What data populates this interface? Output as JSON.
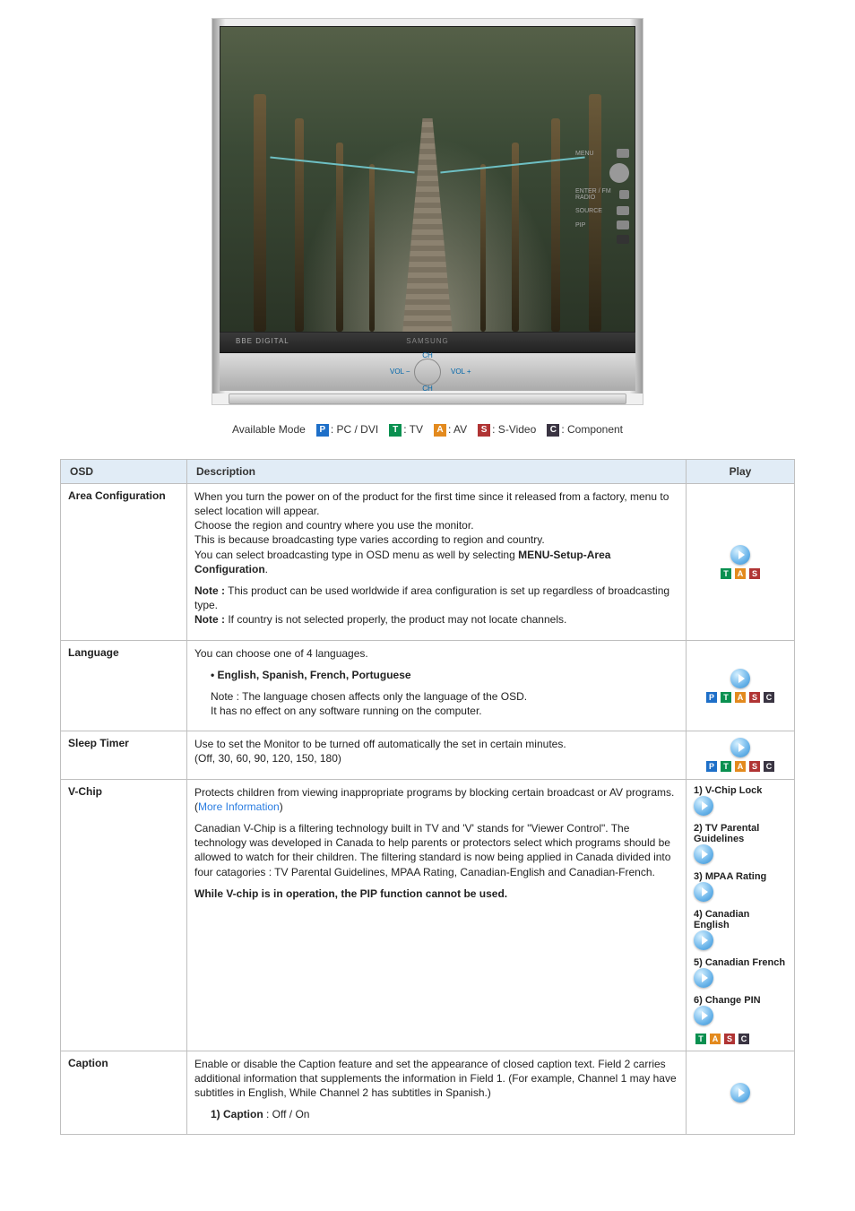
{
  "product_image": {
    "brand_left": "BBE DIGITAL",
    "brand_center": "SAMSUNG",
    "controls": {
      "ch": "CH",
      "vol_minus": "VOL −",
      "vol_plus": "VOL +"
    },
    "side_buttons": [
      "MENU",
      "",
      "ENTER / FM RADIO",
      "SOURCE",
      "PIP",
      ""
    ]
  },
  "mode_line": {
    "prefix": "Available Mode",
    "items": [
      {
        "badge": "P",
        "cls": "m-p",
        "label": ": PC / DVI"
      },
      {
        "badge": "T",
        "cls": "m-t",
        "label": ": TV"
      },
      {
        "badge": "A",
        "cls": "m-a",
        "label": ": AV"
      },
      {
        "badge": "S",
        "cls": "m-s",
        "label": ": S-Video"
      },
      {
        "badge": "C",
        "cls": "m-c",
        "label": ": Component"
      }
    ]
  },
  "table": {
    "headers": {
      "osd": "OSD",
      "desc": "Description",
      "play": "Play"
    },
    "rows": {
      "area": {
        "osd": "Area Configuration",
        "p1": "When you turn the power on of the product for the first time since it released from a factory, menu to select location will appear.",
        "p2": "Choose the region and country where you use the monitor.",
        "p3": "This is because broadcasting type varies according to region and country.",
        "p4_pre": "You can select broadcasting type in OSD menu as well by selecting ",
        "p4_bold": "MENU-Setup-Area Configuration",
        "p4_post": ".",
        "note1_label": "Note :",
        "note1_text": " This product can be used worldwide if area configuration is set up regardless of broadcasting type.",
        "note2_label": "Note :",
        "note2_text": " If country is not selected properly, the product may not locate channels.",
        "play_badges": [
          "T",
          "A",
          "S"
        ]
      },
      "language": {
        "osd": "Language",
        "l1": "You can choose one of 4 languages.",
        "l2": "• English, Spanish, French, Portuguese",
        "l3": "Note : The language chosen affects only the language of the OSD.",
        "l4": "It has no effect on any software running on the computer.",
        "play_badges": [
          "P",
          "T",
          "A",
          "S",
          "C"
        ]
      },
      "sleep": {
        "osd": "Sleep Timer",
        "l1": "Use to set the Monitor to be turned off automatically the set in certain minutes.",
        "l2": "(Off, 30, 60, 90, 120, 150, 180)",
        "play_badges": [
          "P",
          "T",
          "A",
          "S",
          "C"
        ]
      },
      "vchip": {
        "osd": "V-Chip",
        "p1_pre": "Protects children from viewing inappropriate programs by blocking certain broadcast or AV programs. (",
        "p1_link": "More Information",
        "p1_post": ")",
        "p2": "Canadian V-Chip is a filtering technology built in TV and 'V' stands for \"Viewer Control\". The technology was developed in Canada to help parents or protectors select which programs should be allowed to watch for their children. The filtering standard is now being applied in Canada divided into four catagories : TV Parental Guidelines, MPAA Rating, Canadian-English and Canadian-French.",
        "p3": "While V-chip is in operation, the PIP function cannot be used.",
        "play_items": [
          "1) V-Chip Lock",
          "2) TV Parental Guidelines",
          "3) MPAA Rating",
          "4) Canadian English",
          "5) Canadian French",
          "6) Change PIN"
        ],
        "play_badges": [
          "T",
          "A",
          "S",
          "C"
        ]
      },
      "caption": {
        "osd": "Caption",
        "p1": "Enable or disable the Caption feature and set the appearance of closed caption text. Field 2 carries additional information that supplements the information in Field 1. (For example, Channel 1 may have subtitles in English, While Channel 2 has subtitles in Spanish.)",
        "s1_label": "1) Caption",
        "s1_val": " : Off / On"
      }
    }
  }
}
